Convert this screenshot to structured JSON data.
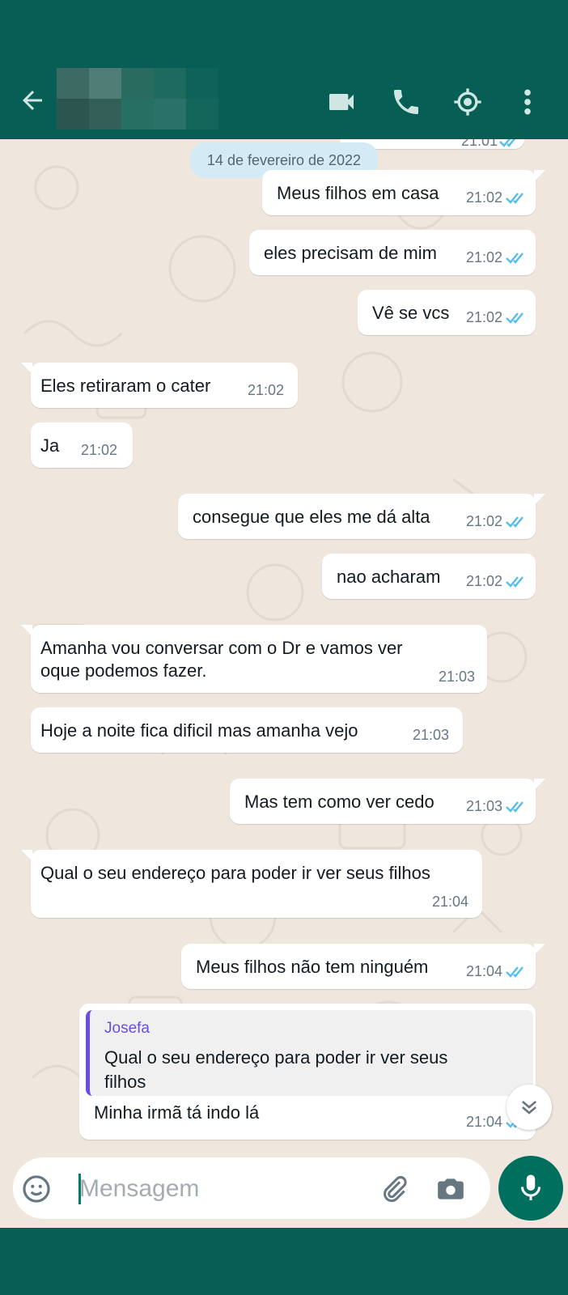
{
  "header": {
    "contact_name": "",
    "back_icon": "arrow-left-icon",
    "video_icon": "video-call-icon",
    "call_icon": "phone-icon",
    "location_icon": "location-target-icon",
    "menu_icon": "more-vert-icon",
    "bg_color": "#075e54"
  },
  "chat": {
    "partial_time": "21:01",
    "date_chip": "14 de fevereiro de 2022",
    "messages": [
      {
        "direction": "out",
        "text": "Meus filhos em casa",
        "time": "21:02",
        "status": "read"
      },
      {
        "direction": "out",
        "text": "eles precisam de mim",
        "time": "21:02",
        "status": "read"
      },
      {
        "direction": "out",
        "text": "Vê se vcs",
        "time": "21:02",
        "status": "read"
      },
      {
        "direction": "in",
        "text": "Eles retiraram o cater",
        "time": "21:02"
      },
      {
        "direction": "in",
        "text": "Ja",
        "time": "21:02"
      },
      {
        "direction": "out",
        "text": "consegue que eles me dá alta",
        "time": "21:02",
        "status": "read"
      },
      {
        "direction": "out",
        "text": "nao acharam",
        "time": "21:02",
        "status": "read"
      },
      {
        "direction": "in",
        "text_line1": "Amanha vou conversar com o Dr e vamos ver",
        "text_line2": "oque podemos fazer.",
        "time": "21:03"
      },
      {
        "direction": "in",
        "text": "Hoje a noite fica dificil mas amanha vejo",
        "time": "21:03"
      },
      {
        "direction": "out",
        "text": "Mas tem como ver cedo",
        "time": "21:03",
        "status": "read"
      },
      {
        "direction": "in",
        "text": "Qual o seu endereço para poder ir ver seus filhos",
        "time": "21:04"
      },
      {
        "direction": "out",
        "text": "Meus filhos não tem ninguém",
        "time": "21:04",
        "status": "read"
      },
      {
        "direction": "out",
        "reply_to_name": "Josefa",
        "reply_line1": "Qual o seu endereço para poder ir ver seus",
        "reply_line2": "filhos",
        "text": "Minha irmã  tá indo lá",
        "time": "21:04",
        "status": "read"
      }
    ],
    "read_tick_color": "#53bdeb"
  },
  "input": {
    "placeholder": "Mensagem",
    "emoji_icon": "emoji-icon",
    "attach_icon": "paperclip-icon",
    "camera_icon": "camera-icon",
    "mic_icon": "microphone-icon",
    "scroll_icon": "double-chevron-down-icon"
  }
}
